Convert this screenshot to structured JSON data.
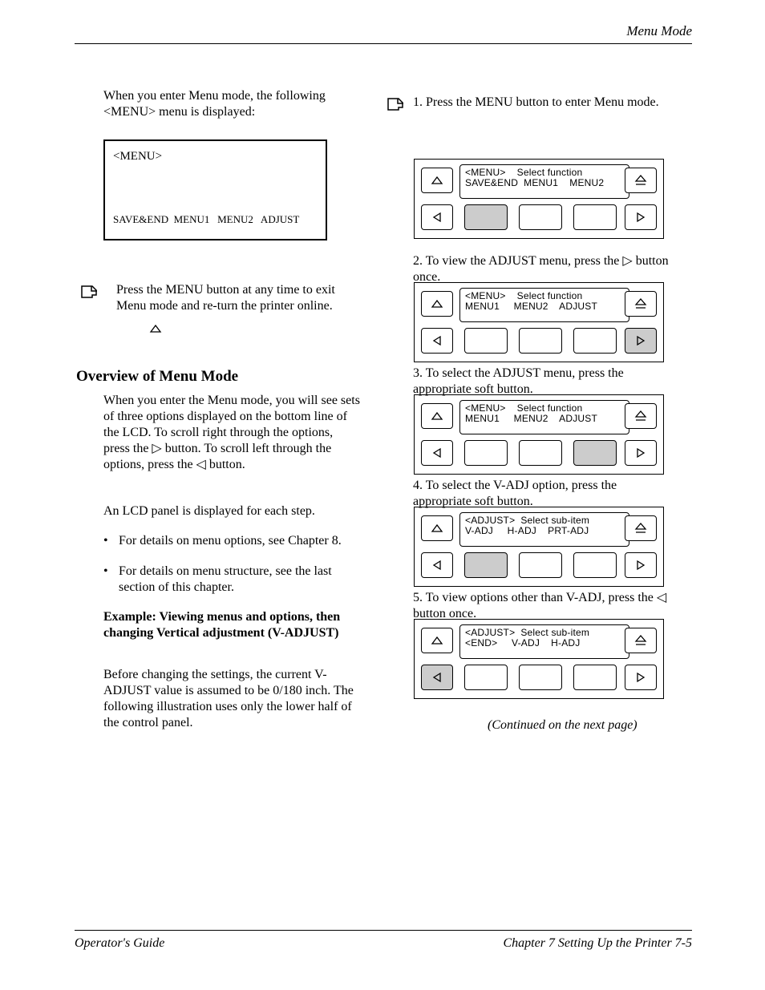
{
  "header": {
    "title": "Menu Mode"
  },
  "footer": {
    "left": "Operator's Guide",
    "right": "Chapter 7 Setting Up the Printer   7-5"
  },
  "left": {
    "intro": "When you enter Menu mode, the following <MENU> menu is displayed:",
    "box": {
      "l1": "<MENU>",
      "l2": "SAVE&END  MENU1   MENU2   ADJUST"
    },
    "note_text": "Press the MENU button at any time to exit Menu mode and return the printer online.",
    "h1": "Overview of Menu Mode",
    "p1": "When you enter the Menu mode, you will see sets of three options displayed on the bottom line of the LCD. To scroll right through the options, press the ▷ button. To scroll left through the options, press the ◁ button.",
    "p2": "An LCD panel is displayed for each step.",
    "bullets": {
      "b1": "For details on menu options, see Chapter 8.",
      "b2": "For details on menu structure, see the last section of this chapter."
    },
    "ex_h": "Example: Viewing menus and options, then changing Vertical adjustment (V-ADJUST)",
    "ex_p": "Before changing the settings, the current V-ADJUST value is assumed to be 0/180 inch. The following illustration uses only the lower half of the control panel."
  },
  "right": {
    "steps": {
      "s1": {
        "n": "1.",
        "t": "Press the MENU button to enter Menu mode."
      },
      "s2": {
        "n": "2.",
        "t": "To view the ADJUST menu, press the ▷ button once."
      },
      "s3": {
        "n": "3.",
        "t": "To select the ADJUST menu, press the appropriate soft button."
      },
      "s4": {
        "n": "4.",
        "t": "To select the V-ADJ option, press the appropriate soft button."
      },
      "s5": {
        "n": "5.",
        "t": "To view options other than V-ADJ, press the ◁ button once."
      }
    },
    "panels": {
      "p1": {
        "line1": "<MENU>    Select function",
        "line2": "SAVE&END  MENU1    MENU2"
      },
      "p2": {
        "line1": "<MENU>    Select function",
        "line2": "MENU1     MENU2    ADJUST"
      },
      "p3": {
        "line1": "<MENU>    Select function",
        "line2": "MENU1     MENU2    ADJUST"
      },
      "p4": {
        "line1": "<ADJUST>  Select sub-item",
        "line2": "V-ADJ     H-ADJ    PRT-ADJ"
      },
      "p5": {
        "line1": "<ADJUST>  Select sub-item",
        "line2": "<END>     V-ADJ    H-ADJ"
      }
    }
  },
  "icons": {
    "up": "up-triangle-icon",
    "left": "left-triangle-icon",
    "right": "right-triangle-icon",
    "eject": "eject-icon",
    "hand": "pointing-hand-icon",
    "open_tri": "open-up-triangle-icon"
  }
}
